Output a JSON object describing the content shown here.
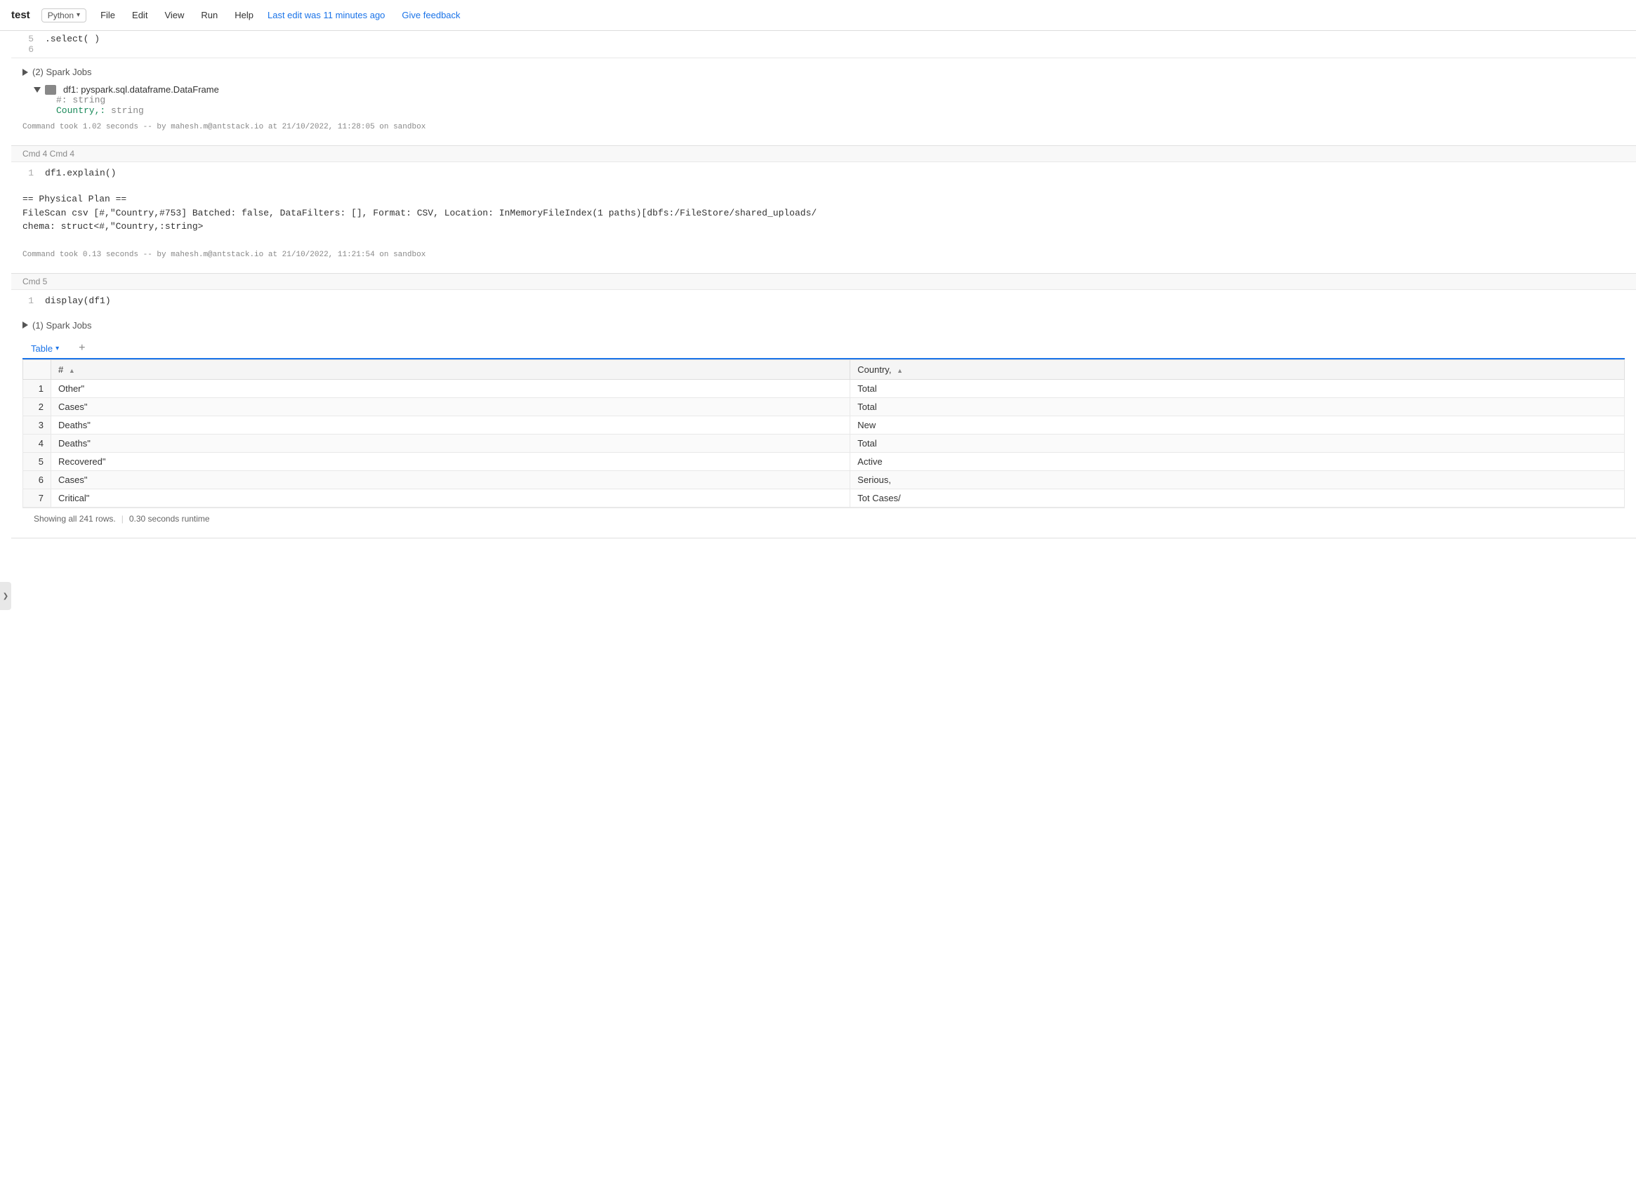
{
  "topbar": {
    "title": "test",
    "python_label": "Python",
    "menu_items": [
      "File",
      "Edit",
      "View",
      "Run",
      "Help"
    ],
    "last_edit": "Last edit was 11 minutes ago",
    "give_feedback": "Give feedback"
  },
  "sidebar_toggle": "❯",
  "cells": [
    {
      "id": "top_snippet",
      "lines": [
        {
          "num": "5",
          "code": ".select( )"
        },
        {
          "num": "6",
          "code": ""
        }
      ]
    },
    {
      "id": "cmd3",
      "cmd_label": "",
      "spark_jobs": "(2) Spark Jobs",
      "dataframe": {
        "label": "df1: pyspark.sql.dataframe.DataFrame",
        "fields": [
          {
            "name": "#:",
            "type": "string",
            "color": "hash"
          },
          {
            "name": "Country,:",
            "type": "string",
            "color": "country"
          }
        ]
      },
      "timing": "Command took 1.02 seconds -- by mahesh.m@antstack.io at 21/10/2022, 11:28:05 on sandbox"
    },
    {
      "id": "cmd4",
      "cmd_label": "Cmd 4",
      "code_lines": [
        {
          "num": "1",
          "code": "df1.explain()"
        }
      ],
      "output_plan": "== Physical Plan ==\nFileScan csv [#,\"Country,#753] Batched: false, DataFilters: [], Format: CSV, Location: InMemoryFileIndex(1 paths)[dbfs:/FileStore/shared_uploads/\nchema: struct<#,\"Country,:string>",
      "timing": "Command took 0.13 seconds -- by mahesh.m@antstack.io at 21/10/2022, 11:21:54 on sandbox"
    },
    {
      "id": "cmd5",
      "cmd_label": "Cmd 5",
      "code_lines": [
        {
          "num": "1",
          "code": "display(df1)"
        }
      ],
      "spark_jobs": "(1) Spark Jobs",
      "table": {
        "tab_label": "Table",
        "columns": [
          {
            "key": "row_num",
            "label": ""
          },
          {
            "key": "hash",
            "label": "#"
          },
          {
            "key": "country",
            "label": "Country,"
          }
        ],
        "rows": [
          {
            "row_num": "1",
            "hash": "Other\"",
            "country": "Total"
          },
          {
            "row_num": "2",
            "hash": "Cases\"",
            "country": "Total"
          },
          {
            "row_num": "3",
            "hash": "Deaths\"",
            "country": "New"
          },
          {
            "row_num": "4",
            "hash": "Deaths\"",
            "country": "Total"
          },
          {
            "row_num": "5",
            "hash": "Recovered\"",
            "country": "Active"
          },
          {
            "row_num": "6",
            "hash": "Cases\"",
            "country": "Serious,"
          },
          {
            "row_num": "7",
            "hash": "Critical\"",
            "country": "Tot Cases/"
          }
        ],
        "footer_rows": "Showing all 241 rows.",
        "footer_runtime": "0.30 seconds runtime"
      }
    }
  ]
}
